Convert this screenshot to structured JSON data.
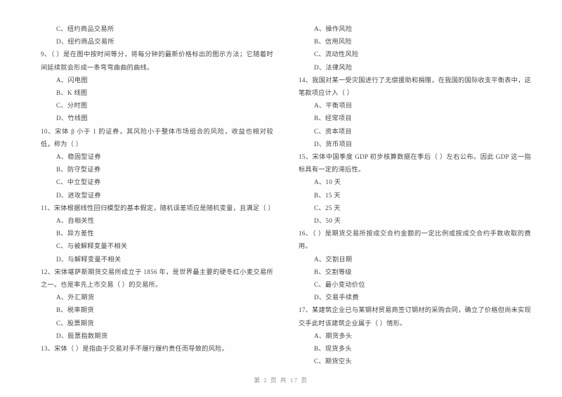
{
  "document": {
    "footer": "第 2 页 共 17 页",
    "page_number": 2,
    "total_pages": 17
  },
  "left_column": {
    "orphan_options": [
      "C、纽约商品交易所",
      "D、纽约商品交易所"
    ],
    "questions": [
      {
        "stem": "9、（        ）是在图中按时间等分，将每分钟的最新价格标出的图示方法；它随着时间延续就会形成一条弯弯曲曲的曲线。",
        "options": [
          "A、闪电图",
          "B、K 线图",
          "C、分时图",
          "D、竹线图"
        ]
      },
      {
        "stem": "10、宋体 β 小于 1 的证券，其风险小于整体市场组合的风险，收益也相对较低，称为（        ）",
        "options": [
          "A、稳固型证券",
          "B、防守型证券",
          "C、中立型证券",
          "D、进攻型证券"
        ]
      },
      {
        "stem": "11、宋体根据线性回归模型的基本假定，随机误差项应是随机变量，且满足（        ）",
        "options": [
          "A、自相关性",
          "B、异方差性",
          "C、与被解释变量不相关",
          "D、与解释变量不相关"
        ]
      },
      {
        "stem": "12、宋体堪萨斯期货交易所成立于 1856 年，是世界最主要的硬冬红小麦交易所之一。也是率先上市交易（        ）的交易所。",
        "options": [
          "A、外汇期货",
          "B、税率期货",
          "C、股票期货",
          "D、股票指数期货"
        ]
      },
      {
        "stem": "13、宋体（        ）是指由于交易对手不履行履约责任而导致的风险。",
        "options": []
      }
    ]
  },
  "right_column": {
    "orphan_options": [
      "A、操作风险",
      "B、信用风险",
      "C、流动性风险",
      "D、法律风险"
    ],
    "questions": [
      {
        "stem": "14、我国对某一受灾国进行了无偿援助和捐赠，在我国的国际收支平衡表中，这笔款项应计入（        ）",
        "options": [
          "A、平衡项目",
          "B、经常项目",
          "C、资本项目",
          "D、货币项目"
        ]
      },
      {
        "stem": "15、宋体中国季度 GDP 初步核算数据在季后（        ）左右公布。因此 GDP 这一指标具有一定的滞后性。",
        "options": [
          "A、10 天",
          "B、15 天",
          "C、25 天",
          "D、50 天"
        ]
      },
      {
        "stem": "16、（        ）是期货交易所按成交合约金额的一定比例或按成交合约手数收取的费用。",
        "options": [
          "A、交割日期",
          "B、交割等级",
          "C、最小变动价位",
          "D、交易手续费"
        ]
      },
      {
        "stem": "17、某建筑企业已与某钢材贸易商签订钢材的采购合同，确立了价格但尚未实现交手此时该建筑企业属于（        ）情形。",
        "options": [
          "A、期货多头",
          "B、现货多头",
          "C、期货空头"
        ]
      }
    ]
  }
}
